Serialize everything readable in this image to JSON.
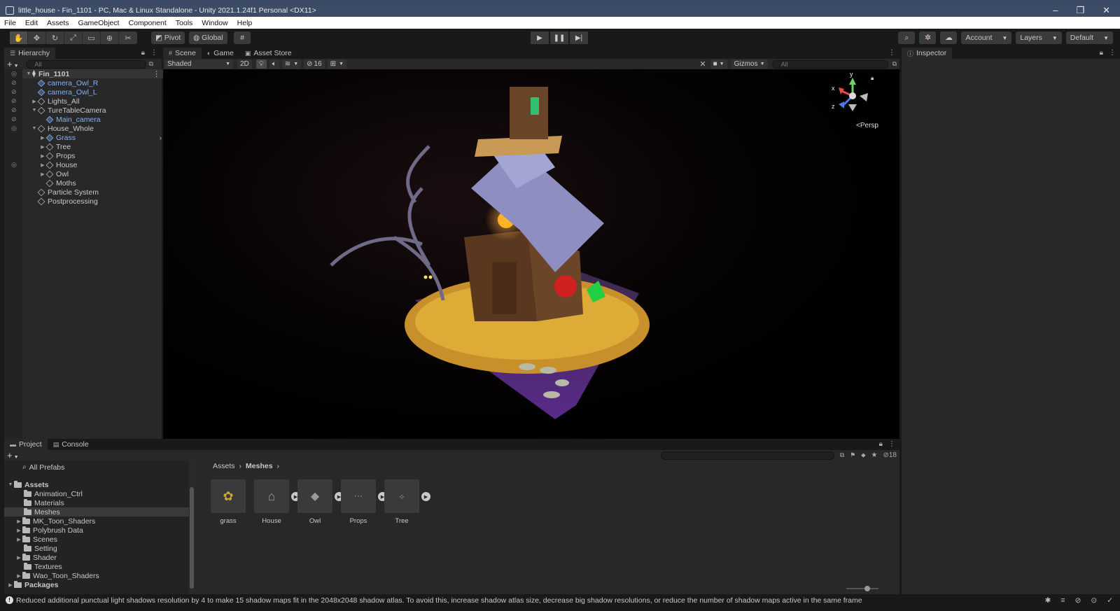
{
  "window": {
    "title": "little_house - Fin_1101 - PC, Mac & Linux Standalone - Unity 2021.1.24f1 Personal <DX11>",
    "controls": [
      "–",
      "❐",
      "✕"
    ]
  },
  "menu": [
    "File",
    "Edit",
    "Assets",
    "GameObject",
    "Component",
    "Tools",
    "Window",
    "Help"
  ],
  "toolbar": {
    "pivot_label": "Pivot",
    "global_label": "Global",
    "account_label": "Account",
    "layers_label": "Layers",
    "layout_label": "Default"
  },
  "hierarchy": {
    "tab": "Hierarchy",
    "search_placeholder": "All",
    "items": [
      {
        "label": "Fin_1101"
      },
      {
        "label": "camera_Owl_R"
      },
      {
        "label": "camera_Owl_L"
      },
      {
        "label": "Lights_All"
      },
      {
        "label": "TureTableCamera"
      },
      {
        "label": "Main_camera"
      },
      {
        "label": "House_Whole"
      },
      {
        "label": "Grass"
      },
      {
        "label": "Tree"
      },
      {
        "label": "Props"
      },
      {
        "label": "House"
      },
      {
        "label": "Owl"
      },
      {
        "label": "Moths"
      },
      {
        "label": "Particle System"
      },
      {
        "label": "Postprocessing"
      }
    ]
  },
  "scene": {
    "tabs": [
      "Scene",
      "Game",
      "Asset Store"
    ],
    "shading_mode": "Shaded",
    "mode_2d": "2D",
    "hidden_count": "16",
    "gizmos_label": "Gizmos",
    "search_placeholder": "All",
    "persp_label": "Persp",
    "axis_y": "y",
    "axis_x": "x",
    "axis_z": "z"
  },
  "inspector": {
    "tab": "Inspector"
  },
  "project": {
    "tabs": [
      "Project",
      "Console"
    ],
    "hidden_count": "18",
    "tree": [
      {
        "label": "All Prefabs"
      },
      {
        "label": "Assets"
      },
      {
        "label": "Animation_Ctrl"
      },
      {
        "label": "Materials"
      },
      {
        "label": "Meshes"
      },
      {
        "label": "MK_Toon_Shaders"
      },
      {
        "label": "Polybrush Data"
      },
      {
        "label": "Scenes"
      },
      {
        "label": "Setting"
      },
      {
        "label": "Shader"
      },
      {
        "label": "Textures"
      },
      {
        "label": "Wao_Toon_Shaders"
      },
      {
        "label": "Packages"
      }
    ],
    "breadcrumb": [
      "Assets",
      "Meshes"
    ],
    "assets": [
      {
        "label": "grass"
      },
      {
        "label": "House"
      },
      {
        "label": "Owl"
      },
      {
        "label": "Props"
      },
      {
        "label": "Tree"
      }
    ]
  },
  "status": {
    "message": "Reduced additional punctual light shadows resolution by 4 to make 15 shadow maps fit in the 2048x2048 shadow atlas. To avoid this, increase shadow atlas size, decrease big shadow resolutions, or reduce the number of shadow maps active in the same frame"
  }
}
